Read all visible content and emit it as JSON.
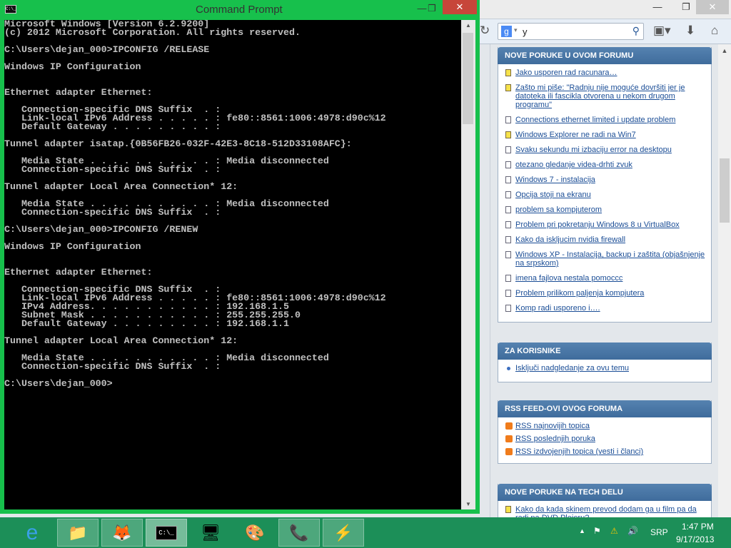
{
  "cmd": {
    "title": "Command Prompt",
    "app_icon_text": "C:\\_",
    "lines": [
      "Microsoft Windows [Version 6.2.9200]",
      "(c) 2012 Microsoft Corporation. All rights reserved.",
      "",
      "C:\\Users\\dejan_000>IPCONFIG /RELEASE",
      "",
      "Windows IP Configuration",
      "",
      "",
      "Ethernet adapter Ethernet:",
      "",
      "   Connection-specific DNS Suffix  . :",
      "   Link-local IPv6 Address . . . . . : fe80::8561:1006:4978:d90c%12",
      "   Default Gateway . . . . . . . . . :",
      "",
      "Tunnel adapter isatap.{0B56FB26-032F-42E3-8C18-512D33108AFC}:",
      "",
      "   Media State . . . . . . . . . . . : Media disconnected",
      "   Connection-specific DNS Suffix  . :",
      "",
      "Tunnel adapter Local Area Connection* 12:",
      "",
      "   Media State . . . . . . . . . . . : Media disconnected",
      "   Connection-specific DNS Suffix  . :",
      "",
      "C:\\Users\\dejan_000>IPCONFIG /RENEW",
      "",
      "Windows IP Configuration",
      "",
      "",
      "Ethernet adapter Ethernet:",
      "",
      "   Connection-specific DNS Suffix  . :",
      "   Link-local IPv6 Address . . . . . : fe80::8561:1006:4978:d90c%12",
      "   IPv4 Address. . . . . . . . . . . : 192.168.1.5",
      "   Subnet Mask . . . . . . . . . . . : 255.255.255.0",
      "   Default Gateway . . . . . . . . . : 192.168.1.1",
      "",
      "Tunnel adapter Local Area Connection* 12:",
      "",
      "   Media State . . . . . . . . . . . : Media disconnected",
      "   Connection-specific DNS Suffix  . :",
      "",
      "C:\\Users\\dejan_000>"
    ]
  },
  "browser": {
    "search_value": "y",
    "search_engine_letter": "g",
    "panels": [
      {
        "title": "NOVE PORUKE U OVOM FORUMU",
        "items": [
          {
            "icon": "new",
            "text": "Jako usporen rad racunara…"
          },
          {
            "icon": "new",
            "text": "Zašto mi piše: \"Radnju nije moguće dovršiti jer je datoteka ili fascikla otvorena u nekom drugom programu\""
          },
          {
            "icon": "old",
            "text": "Connections ethernet limited i update problem"
          },
          {
            "icon": "new",
            "text": "Windows Explorer ne radi na Win7"
          },
          {
            "icon": "old",
            "text": "Svaku sekundu mi izbaciju error na desktopu"
          },
          {
            "icon": "old",
            "text": "otezano gledanje videa-drhti zvuk"
          },
          {
            "icon": "old",
            "text": "Windows 7 - instalacija"
          },
          {
            "icon": "old",
            "text": "Opcija stoji na ekranu"
          },
          {
            "icon": "old",
            "text": "problem sa kompjuterom"
          },
          {
            "icon": "old",
            "text": "Problem pri pokretanju Windows 8 u VirtualBox"
          },
          {
            "icon": "old",
            "text": "Kako da iskljucim nvidia firewall"
          },
          {
            "icon": "old",
            "text": "Windows XP - Instalacija, backup i zaštita (objašnjenje na srpskom)"
          },
          {
            "icon": "old",
            "text": "imena fajlova nestala pomoccc"
          },
          {
            "icon": "old",
            "text": "Problem prilikom paljenja kompjutera"
          },
          {
            "icon": "old",
            "text": "Komp radi usporeno i…."
          }
        ]
      },
      {
        "title": "ZA KORISNIKE",
        "items": [
          {
            "icon": "dot",
            "text": "Isključi nadgledanje za ovu temu"
          }
        ]
      },
      {
        "title": "RSS FEED-OVI OVOG FORUMA",
        "items": [
          {
            "icon": "rss",
            "text": "RSS najnovijih topica"
          },
          {
            "icon": "rss",
            "text": "RSS poslednjih poruka"
          },
          {
            "icon": "rss",
            "text": "RSS izdvojenjih topica (vesti i članci)"
          }
        ]
      },
      {
        "title": "NOVE PORUKE NA TECH DELU",
        "items": [
          {
            "icon": "new",
            "text": "Kako da kada skinem prevod dodam ga u film pa da radi na DVD Plejeru?"
          }
        ]
      }
    ]
  },
  "taskbar": {
    "language": "SRP",
    "time": "1:47 PM",
    "date": "9/17/2013"
  }
}
